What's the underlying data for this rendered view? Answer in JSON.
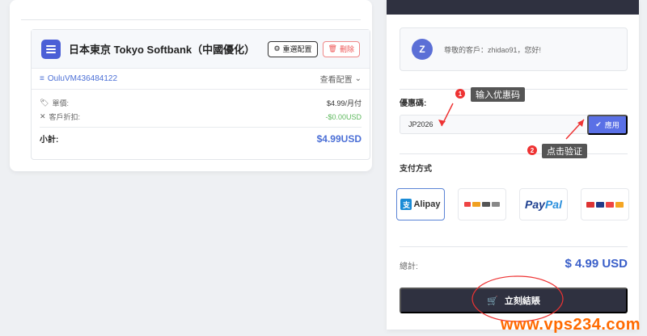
{
  "cart": {
    "product_title": "日本東京 Tokyo Softbank（中國優化）",
    "reconfig_label": "重選配置",
    "delete_label": "刪除",
    "vm_id": "OuluVM436484122",
    "view_config_label": "查看配置",
    "unit_price_label": "單價:",
    "unit_price_value": "$4.99/月付",
    "discount_label": "客戶折扣:",
    "discount_value": "-$0.00USD",
    "subtotal_label": "小計:",
    "subtotal_value": "$4.99USD"
  },
  "checkout": {
    "avatar_letter": "Z",
    "greeting": "尊敬的客戶：zhidao91，您好!",
    "coupon_label": "優惠碼:",
    "coupon_value": "JP2026",
    "apply_label": "應用",
    "payment_label": "支付方式",
    "payment_methods": [
      {
        "name": "Alipay",
        "selected": true
      },
      {
        "name": "multi-bank",
        "selected": false
      },
      {
        "name": "PayPal",
        "selected": false
      },
      {
        "name": "cards",
        "selected": false
      }
    ],
    "total_label": "總計:",
    "total_value": "$ 4.99 USD",
    "checkout_label": "立刻結賬"
  },
  "annotations": {
    "step1_num": "1",
    "step1_text": "输入优惠码",
    "step2_num": "2",
    "step2_text": "点击验证"
  },
  "watermark": "www.vps234.com",
  "colors": {
    "accent": "#5a70e6",
    "dark": "#2f3140",
    "price_blue": "#3a5fc9",
    "annotation_red": "#e33"
  }
}
